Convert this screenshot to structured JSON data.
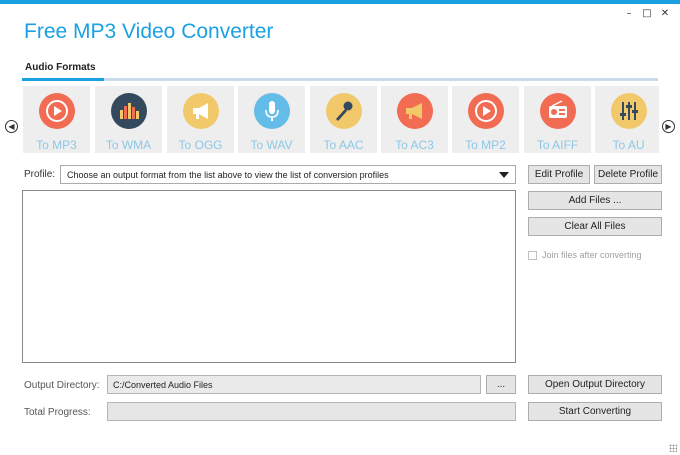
{
  "window": {
    "title": "Free MP3 Video Converter",
    "controls": {
      "minimize": "–",
      "maximize": "□",
      "close": "✕"
    }
  },
  "tabs": [
    {
      "label": "Audio Formats",
      "active": true
    }
  ],
  "formats": [
    {
      "label": "To MP3",
      "icon": "play-icon",
      "color": "#f26b53"
    },
    {
      "label": "To WMA",
      "icon": "equalizer-icon",
      "color": "#34495e"
    },
    {
      "label": "To OGG",
      "icon": "megaphone-icon",
      "color": "#f2c96a"
    },
    {
      "label": "To WAV",
      "icon": "microphone-icon",
      "color": "#64bce8"
    },
    {
      "label": "To AAC",
      "icon": "mic-icon",
      "color": "#f2c96a"
    },
    {
      "label": "To AC3",
      "icon": "bullhorn-icon",
      "color": "#f26b53"
    },
    {
      "label": "To MP2",
      "icon": "play-icon",
      "color": "#f26b53"
    },
    {
      "label": "To AIFF",
      "icon": "radio-icon",
      "color": "#f26b53"
    },
    {
      "label": "To AU",
      "icon": "sliders-icon",
      "color": "#f2c96a"
    }
  ],
  "profile": {
    "label": "Profile:",
    "selected": "Choose an output format from the list above to view the list of conversion profiles"
  },
  "buttons": {
    "edit_profile": "Edit Profile",
    "delete_profile": "Delete Profile",
    "add_files": "Add Files ...",
    "clear_all": "Clear All Files",
    "browse": "...",
    "open_output": "Open Output Directory",
    "start": "Start Converting"
  },
  "join_files": {
    "label": "Join files after converting",
    "checked": false,
    "enabled": false
  },
  "output": {
    "label": "Output Directory:",
    "value": "C:/Converted Audio Files"
  },
  "progress": {
    "label": "Total Progress:",
    "value": 0
  },
  "colors": {
    "accent": "#1ba1e2",
    "tile_bg": "#eeeeee",
    "tile_label": "#8cc8e6"
  }
}
